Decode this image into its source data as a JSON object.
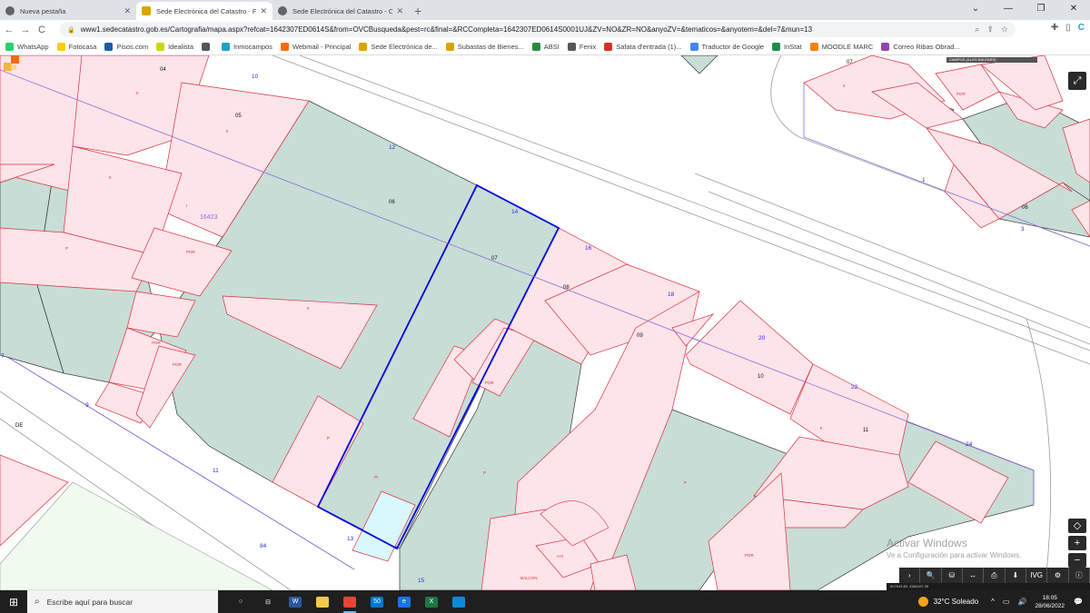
{
  "browser": {
    "tabs": [
      {
        "title": "Nueva pestaña",
        "active": false
      },
      {
        "title": "Sede Electrónica del Catastro - F",
        "active": true
      },
      {
        "title": "Sede Electrónica del Catastro - C",
        "active": false
      }
    ],
    "new_tab_label": "+",
    "window_controls": {
      "collapse": "⌄",
      "minimize": "—",
      "maximize": "❐",
      "close": "✕"
    },
    "nav": {
      "back": "←",
      "forward": "→",
      "reload": "C"
    },
    "url": "www1.sedecatastro.gob.es/Cartografia/mapa.aspx?refcat=1642307ED0614S&from=OVCBusqueda&pest=rc&final=&RCCompleta=1642307ED0614S0001UJ&ZV=NO&ZR=NO&anyoZV=&tematicos=&anyotem=&del=7&mun=13",
    "omnibox_icons": [
      "zoom-icon",
      "share-icon",
      "star-icon"
    ],
    "extension_icons": [
      "puzzle-icon",
      "sidebar-icon",
      "c-extension-icon"
    ],
    "bookmarks": [
      {
        "label": "WhatsApp",
        "color": "#25d366"
      },
      {
        "label": "Fotocasa",
        "color": "#ffcc00"
      },
      {
        "label": "Pisos.com",
        "color": "#1e5aa8"
      },
      {
        "label": "Idealista",
        "color": "#c7da00"
      },
      {
        "label": "",
        "color": "#555555"
      },
      {
        "label": "Inmocampos",
        "color": "#1aa3c4"
      },
      {
        "label": "Webmail - Principal",
        "color": "#ff6a00"
      },
      {
        "label": "Sede Electrónica de...",
        "color": "#d9a400"
      },
      {
        "label": "Subastas de Bienes...",
        "color": "#d9a400"
      },
      {
        "label": "ABSI",
        "color": "#2b8a3e"
      },
      {
        "label": "Fenix",
        "color": "#555555"
      },
      {
        "label": "Safata d'entrada (1)...",
        "color": "#d93025"
      },
      {
        "label": "Traductor de Google",
        "color": "#4285f4"
      },
      {
        "label": "InStat",
        "color": "#1f8a4c"
      },
      {
        "label": "MOODLE MARC",
        "color": "#f98012"
      },
      {
        "label": "Correo Ribas Obrad...",
        "color": "#8e44ad"
      }
    ]
  },
  "map": {
    "colors": {
      "parcel_green": "#c8ddd5",
      "building_pink": "#fce4e9",
      "selected_blue": "#0000dd",
      "pool_cyan": "#d8f8fc",
      "street_lilac": "#8a6bd8"
    },
    "parcel_numbers": [
      "04",
      "05",
      "06",
      "07",
      "08",
      "09",
      "10",
      "11"
    ],
    "other_numbers": [
      "07",
      "06"
    ],
    "block_label": "16423",
    "street_numbers": [
      "10",
      "12",
      "14",
      "16",
      "18",
      "20",
      "22",
      "24",
      "7",
      "9",
      "11",
      "13",
      "15",
      "3",
      "84",
      "1"
    ],
    "street_name": "DE",
    "building_tags": [
      "I",
      "II",
      "P",
      "POR",
      "PI",
      "BALCON",
      "-I+II"
    ],
    "coord_strip": "CAMPOS (ILLES BALEARS)",
    "fullscreen_label": "⤢",
    "zoom_buttons": {
      "locate": "◇",
      "zoom_in": "+",
      "zoom_out": "−"
    },
    "toolbar": [
      {
        "label": "›",
        "name": "toolbar-next-button"
      },
      {
        "label": "🔍",
        "name": "toolbar-search-button"
      },
      {
        "label": "⛁",
        "name": "toolbar-layers-button"
      },
      {
        "label": "↔",
        "name": "toolbar-measure-button"
      },
      {
        "label": "⎙",
        "name": "toolbar-print-button"
      },
      {
        "label": "⬇",
        "name": "toolbar-download-button"
      },
      {
        "label": "IVG",
        "name": "toolbar-ivg-button"
      },
      {
        "label": "⚙",
        "name": "toolbar-tools-button"
      },
      {
        "label": "ⓘ",
        "name": "toolbar-info-button"
      }
    ],
    "info_strip": "507843.80, 4384197.35",
    "watermark_title": "Activar Windows",
    "watermark_subtitle": "Ve a Configuración para activar Windows."
  },
  "taskbar": {
    "start": "⊞",
    "search_placeholder": "Escribe aquí para buscar",
    "search_icon": "⌕",
    "apps": [
      {
        "name": "taskview-icon",
        "label": "○",
        "color": "transparent"
      },
      {
        "name": "widgets-icon",
        "label": "⊟",
        "color": "transparent"
      },
      {
        "name": "word-icon",
        "label": "W",
        "color": "#2b579a"
      },
      {
        "name": "explorer-icon",
        "label": "",
        "color": "#f2c94c"
      },
      {
        "name": "chrome-icon",
        "label": "",
        "color": "#ea4335"
      },
      {
        "name": "mail-icon",
        "label": "50",
        "color": "#0078d4"
      },
      {
        "name": "edge-legacy-icon",
        "label": "e",
        "color": "#1a73e8"
      },
      {
        "name": "excel-icon",
        "label": "X",
        "color": "#217346"
      },
      {
        "name": "edge-icon",
        "label": "",
        "color": "#0c8bd8"
      }
    ],
    "weather": "32°C  Soleado",
    "tray_icons": [
      "^",
      "▭",
      "🔊"
    ],
    "time": "18:05",
    "date": "28/06/2022",
    "notifications": "💬"
  }
}
